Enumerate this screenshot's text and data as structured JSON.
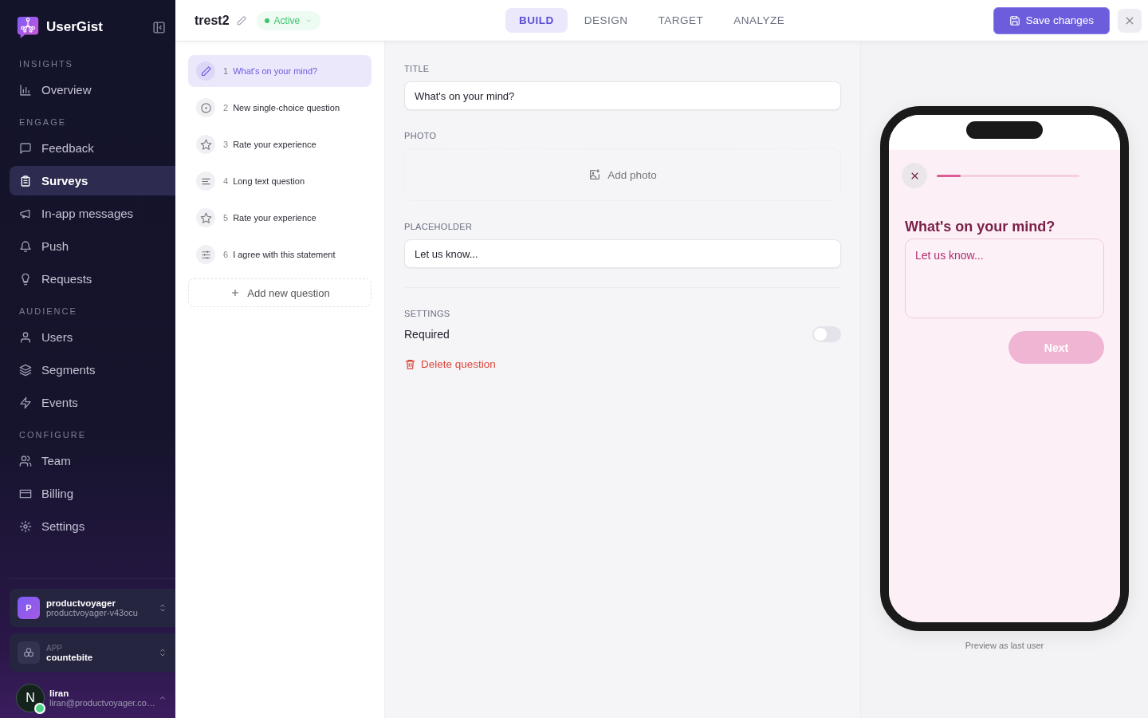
{
  "sidebar": {
    "brand": "UserGist",
    "sections": [
      {
        "heading": "INSIGHTS",
        "items": [
          {
            "label": "Overview",
            "selected": false
          }
        ]
      },
      {
        "heading": "ENGAGE",
        "items": [
          {
            "label": "Feedback",
            "selected": false
          },
          {
            "label": "Surveys",
            "selected": true
          },
          {
            "label": "In-app messages",
            "selected": false
          },
          {
            "label": "Push",
            "selected": false
          },
          {
            "label": "Requests",
            "selected": false
          }
        ]
      },
      {
        "heading": "AUDIENCE",
        "items": [
          {
            "label": "Users",
            "selected": false
          },
          {
            "label": "Segments",
            "selected": false
          },
          {
            "label": "Events",
            "selected": false
          }
        ]
      },
      {
        "heading": "CONFIGURE",
        "items": [
          {
            "label": "Team",
            "selected": false
          },
          {
            "label": "Billing",
            "selected": false
          },
          {
            "label": "Settings",
            "selected": false
          }
        ]
      }
    ],
    "organization": {
      "initial": "P",
      "name": "productvoyager",
      "slug": "productvoyager-v43ocu"
    },
    "app": {
      "label": "APP",
      "name": "countebite"
    },
    "user": {
      "initial": "N",
      "name": "liran",
      "email": "liran@productvoyager.co…",
      "online": true
    }
  },
  "header": {
    "survey_title": "trest2",
    "status": "Active",
    "tabs": [
      {
        "label": "BUILD",
        "selected": true
      },
      {
        "label": "DESIGN",
        "selected": false
      },
      {
        "label": "TARGET",
        "selected": false
      },
      {
        "label": "ANALYZE",
        "selected": false
      }
    ],
    "save_button": "Save changes"
  },
  "questions": [
    {
      "number": "1",
      "title": "What's on your mind?",
      "kind": "text",
      "selected": true
    },
    {
      "number": "2",
      "title": "New single-choice question",
      "kind": "single-choice",
      "selected": false
    },
    {
      "number": "3",
      "title": "Rate your experience",
      "kind": "rating",
      "selected": false
    },
    {
      "number": "4",
      "title": "Long text question",
      "kind": "long-text",
      "selected": false
    },
    {
      "number": "5",
      "title": "Rate your experience",
      "kind": "rating",
      "selected": false
    },
    {
      "number": "6",
      "title": "I agree with this statement",
      "kind": "statement",
      "selected": false
    }
  ],
  "add_question": "Add new question",
  "editor": {
    "title_field": {
      "label": "TITLE",
      "value": "What's on your mind?"
    },
    "photo_label": "PHOTO",
    "add_photo": "Add photo",
    "placeholder_field": {
      "label": "PLACEHOLDER",
      "value": "Let us know..."
    },
    "settings_label": "SETTINGS",
    "required": {
      "label": "Required",
      "on": false
    },
    "delete": "Delete question"
  },
  "preview": {
    "level": 0.17,
    "question": "What's on your mind?",
    "placeholder": "Let us know...",
    "next": "Next",
    "caption": "Preview as last user"
  }
}
